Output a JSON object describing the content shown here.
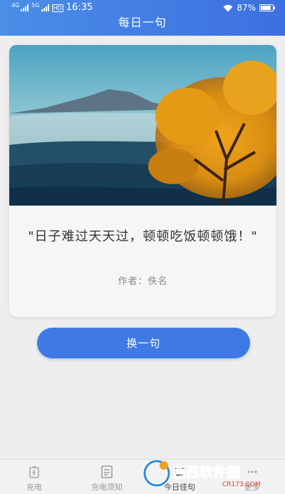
{
  "status_bar": {
    "net1": "4G",
    "net2": "5G",
    "hd": "HD",
    "time": "16:35",
    "battery": "87%",
    "battery_level": 0.87
  },
  "header": {
    "title": "每日一句"
  },
  "card": {
    "quote": "\"日子难过天天过，顿顿吃饭顿顿饿！\"",
    "author": "作者：佚名"
  },
  "actions": {
    "next_label": "换一句"
  },
  "tabs": [
    {
      "label": "充电",
      "icon": "charge-icon",
      "active": false
    },
    {
      "label": "充电须知",
      "icon": "notice-icon",
      "active": false
    },
    {
      "label": "今日佳句",
      "icon": "quote-icon",
      "active": true
    },
    {
      "label": "更多",
      "icon": "more-icon",
      "active": false
    }
  ],
  "watermark": {
    "text": "西西软件园",
    "sub": "CR173.COM"
  },
  "colors": {
    "primary": "#3f7ae4",
    "header_start": "#4a8ee6",
    "header_end": "#3d6fe0"
  }
}
